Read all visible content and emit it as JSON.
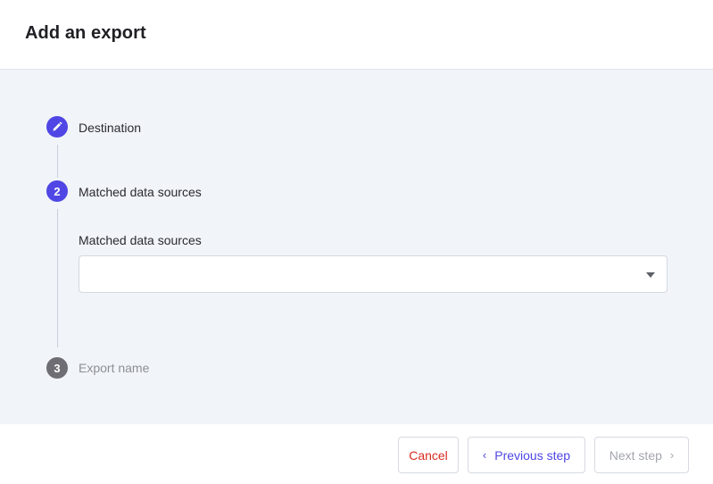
{
  "dialog": {
    "title": "Add an export"
  },
  "steps": [
    {
      "number": "",
      "icon": "pencil-icon",
      "label": "Destination",
      "state": "completed"
    },
    {
      "number": "2",
      "label": "Matched data sources",
      "state": "active"
    },
    {
      "number": "3",
      "label": "Export name",
      "state": "inactive"
    }
  ],
  "field": {
    "label": "Matched data sources",
    "value": ""
  },
  "footer": {
    "cancel_label": "Cancel",
    "previous_label": "Previous step",
    "next_label": "Next step"
  },
  "colors": {
    "accent": "#4f46e5",
    "danger": "#d92d20",
    "inactive_step": "#6d6d73",
    "body_background": "#f1f4f9"
  }
}
